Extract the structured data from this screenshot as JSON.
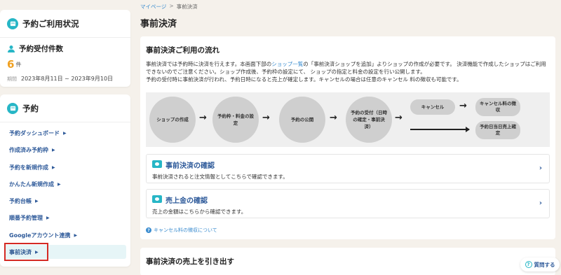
{
  "sidebar": {
    "status_card": {
      "title": "予約ご利用状況",
      "sub_label": "予約受付件数",
      "count": "6",
      "count_unit": "件",
      "period_label": "期間",
      "period_value": "2023年8月11日 ~ 2023年9月10日"
    },
    "reservation_card": {
      "title": "予約",
      "items": [
        {
          "label": "予約ダッシュボード"
        },
        {
          "label": "作成済み予約枠"
        },
        {
          "label": "予約を新規作成"
        },
        {
          "label": "かんたん新規作成"
        },
        {
          "label": "予約台帳"
        },
        {
          "label": "順番予約管理"
        },
        {
          "label": "Googleアカウント連携"
        },
        {
          "label": "事前決済"
        }
      ]
    }
  },
  "breadcrumb": {
    "home": "マイページ",
    "sep": ">",
    "current": "事前決済"
  },
  "page_title": "事前決済",
  "main": {
    "section_title": "事前決済ご利用の流れ",
    "desc_part1": "事前決済では予約時に決済を行えます。本画面下部の",
    "desc_link": "ショップ一覧",
    "desc_part2": "の「事前決済ショップを追加」よりショップの作成が必要です。 決済機能で作成したショップはご利用できないのでご注意ください。ショップ作成後、予約枠の設定にて、 ショップの指定と料金の設定を行い公開します。",
    "desc_line3": "予約の受付時に事前決済が行われ、予約日時になると売上が確定します。キャンセルの場合は任意のキャンセル 料の徴収も可能です。",
    "flow": {
      "step1": "ショップの作成",
      "step2": "予約枠・料金の設定",
      "step3": "予約の公開",
      "step4": "予約の受付（日時の確定・事前決済）",
      "cancel": "キャンセル",
      "cancel_fee": "キャンセル料の徴収",
      "sale_confirm": "予約日当日売上確定",
      "arrow": "→"
    },
    "link_cards": [
      {
        "title": "事前決済の確認",
        "desc": "事前決済されると注文情報としてこちらで確認できます。",
        "chevron": "›"
      },
      {
        "title": "売上金の確認",
        "desc": "売上の金額はこちらから確認できます。",
        "chevron": "›"
      }
    ],
    "cancel_fee_link": "キャンセル料の徴収について",
    "section2_title": "事前決済の売上を引き出す"
  },
  "help_button": "質問する",
  "colors": {
    "accent": "#27b6c6",
    "link": "#3a8ccf",
    "highlight": "#d42a24",
    "count": "#f0a020"
  },
  "icons": {
    "calendar": "calendar-icon",
    "person": "person-icon",
    "question": "question-icon",
    "video": "video-icon"
  }
}
